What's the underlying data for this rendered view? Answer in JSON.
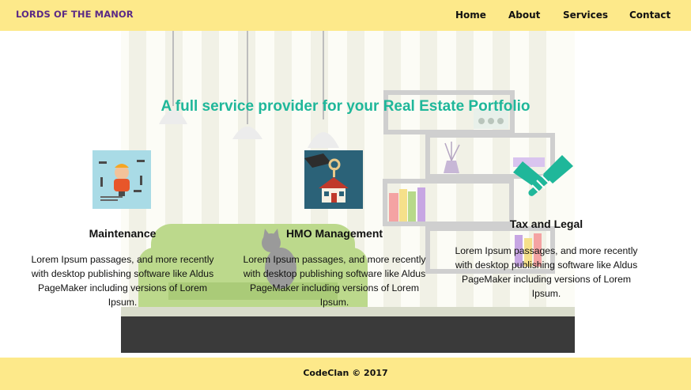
{
  "header": {
    "brand": "LORDS OF THE MANOR",
    "nav": [
      "Home",
      "About",
      "Services",
      "Contact"
    ]
  },
  "hero": {
    "headline": "A full service provider for your Real Estate Portfolio"
  },
  "services": [
    {
      "title": "Maintenance",
      "text": "Lorem Ipsum passages, and more recently with desktop publishing software like Aldus PageMaker including versions of Lorem Ipsum.",
      "icon": "handyman-icon"
    },
    {
      "title": "HMO Management",
      "text": "Lorem Ipsum passages, and more recently with desktop publishing software like Aldus PageMaker including versions of Lorem Ipsum.",
      "icon": "house-keys-icon"
    },
    {
      "title": "Tax and Legal",
      "text": "Lorem Ipsum passages, and more recently with desktop publishing software like Aldus PageMaker including versions of Lorem Ipsum.",
      "icon": "handshake-icon"
    }
  ],
  "footer": {
    "text": "CodeClan © 2017"
  },
  "colors": {
    "header_bg": "#fde98a",
    "brand": "#5b2a86",
    "accent": "#1fb79a",
    "sofa": "#bcd98c",
    "floor": "#3a3a3a"
  }
}
